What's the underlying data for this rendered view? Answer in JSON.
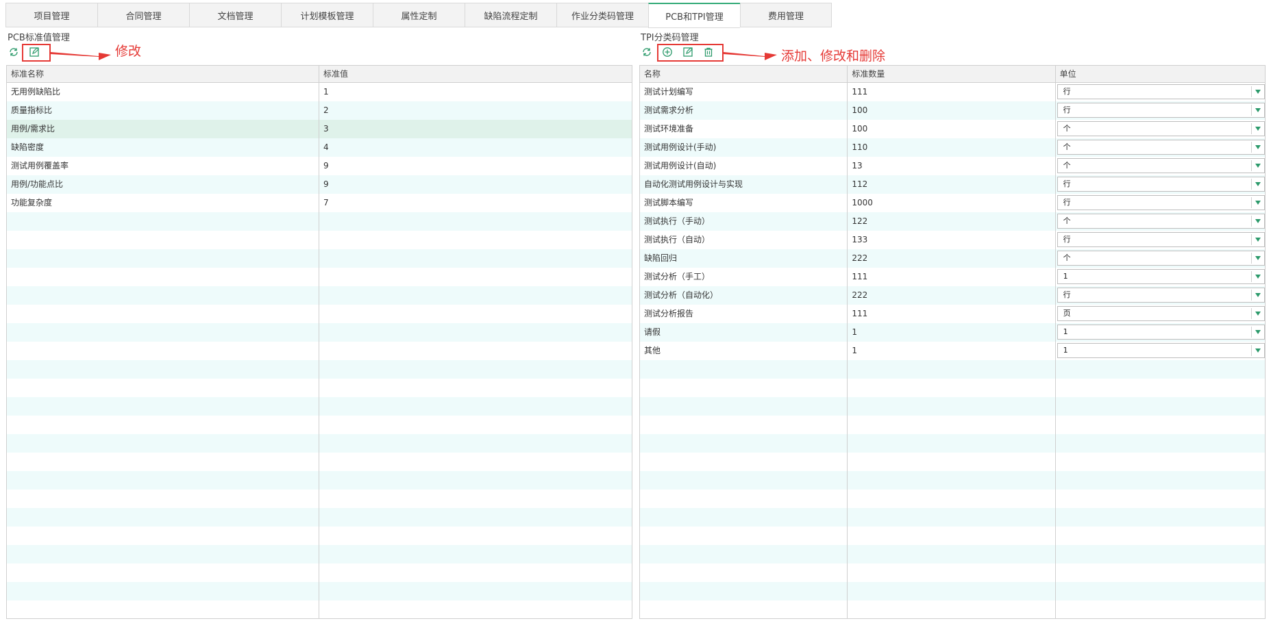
{
  "tabs": [
    {
      "label": "项目管理"
    },
    {
      "label": "合同管理"
    },
    {
      "label": "文档管理"
    },
    {
      "label": "计划模板管理"
    },
    {
      "label": "属性定制"
    },
    {
      "label": "缺陷流程定制"
    },
    {
      "label": "作业分类码管理"
    },
    {
      "label": "PCB和TPI管理"
    },
    {
      "label": "费用管理"
    }
  ],
  "active_tab": "PCB和TPI管理",
  "pcb": {
    "title": "PCB标准值管理",
    "toolbar": {
      "icons": [
        "refresh-icon",
        "edit-icon"
      ]
    },
    "annotation": "修改",
    "columns": [
      "标准名称",
      "标准值"
    ],
    "rows": [
      {
        "name": "无用例缺陷比",
        "value": "1"
      },
      {
        "name": "质量指标比",
        "value": "2"
      },
      {
        "name": "用例/需求比",
        "value": "3"
      },
      {
        "name": "缺陷密度",
        "value": "4"
      },
      {
        "name": "测试用例覆盖率",
        "value": "9"
      },
      {
        "name": "用例/功能点比",
        "value": "9"
      },
      {
        "name": "功能复杂度",
        "value": "7"
      }
    ],
    "selected_row": 2
  },
  "tpi": {
    "title": "TPI分类码管理",
    "toolbar": {
      "icons": [
        "refresh-icon",
        "add-icon",
        "edit-icon",
        "delete-icon"
      ]
    },
    "annotation": "添加、修改和删除",
    "columns": [
      "名称",
      "标准数量",
      "单位"
    ],
    "rows": [
      {
        "name": "测试计划编写",
        "count": "111",
        "unit": "行"
      },
      {
        "name": "测试需求分析",
        "count": "100",
        "unit": "行"
      },
      {
        "name": "测试环境准备",
        "count": "100",
        "unit": "个"
      },
      {
        "name": "测试用例设计(手动)",
        "count": "110",
        "unit": "个"
      },
      {
        "name": "测试用例设计(自动)",
        "count": "13",
        "unit": "个"
      },
      {
        "name": "自动化测试用例设计与实现",
        "count": "112",
        "unit": "行"
      },
      {
        "name": "测试脚本编写",
        "count": "1000",
        "unit": "行"
      },
      {
        "name": "测试执行（手动）",
        "count": "122",
        "unit": "个"
      },
      {
        "name": "测试执行（自动）",
        "count": "133",
        "unit": "行"
      },
      {
        "name": "缺陷回归",
        "count": "222",
        "unit": "个"
      },
      {
        "name": "测试分析（手工）",
        "count": "111",
        "unit": "1"
      },
      {
        "name": "测试分析（自动化）",
        "count": "222",
        "unit": "行"
      },
      {
        "name": "测试分析报告",
        "count": "111",
        "unit": "页"
      },
      {
        "name": "请假",
        "count": "1",
        "unit": "1"
      },
      {
        "name": "其他",
        "count": "1",
        "unit": "1"
      }
    ]
  },
  "colors": {
    "accent": "#33aa77",
    "icon": "#2c9a6b",
    "annotation": "#e53935",
    "stripe": "#eefbfb",
    "selected": "#dff2ea"
  }
}
